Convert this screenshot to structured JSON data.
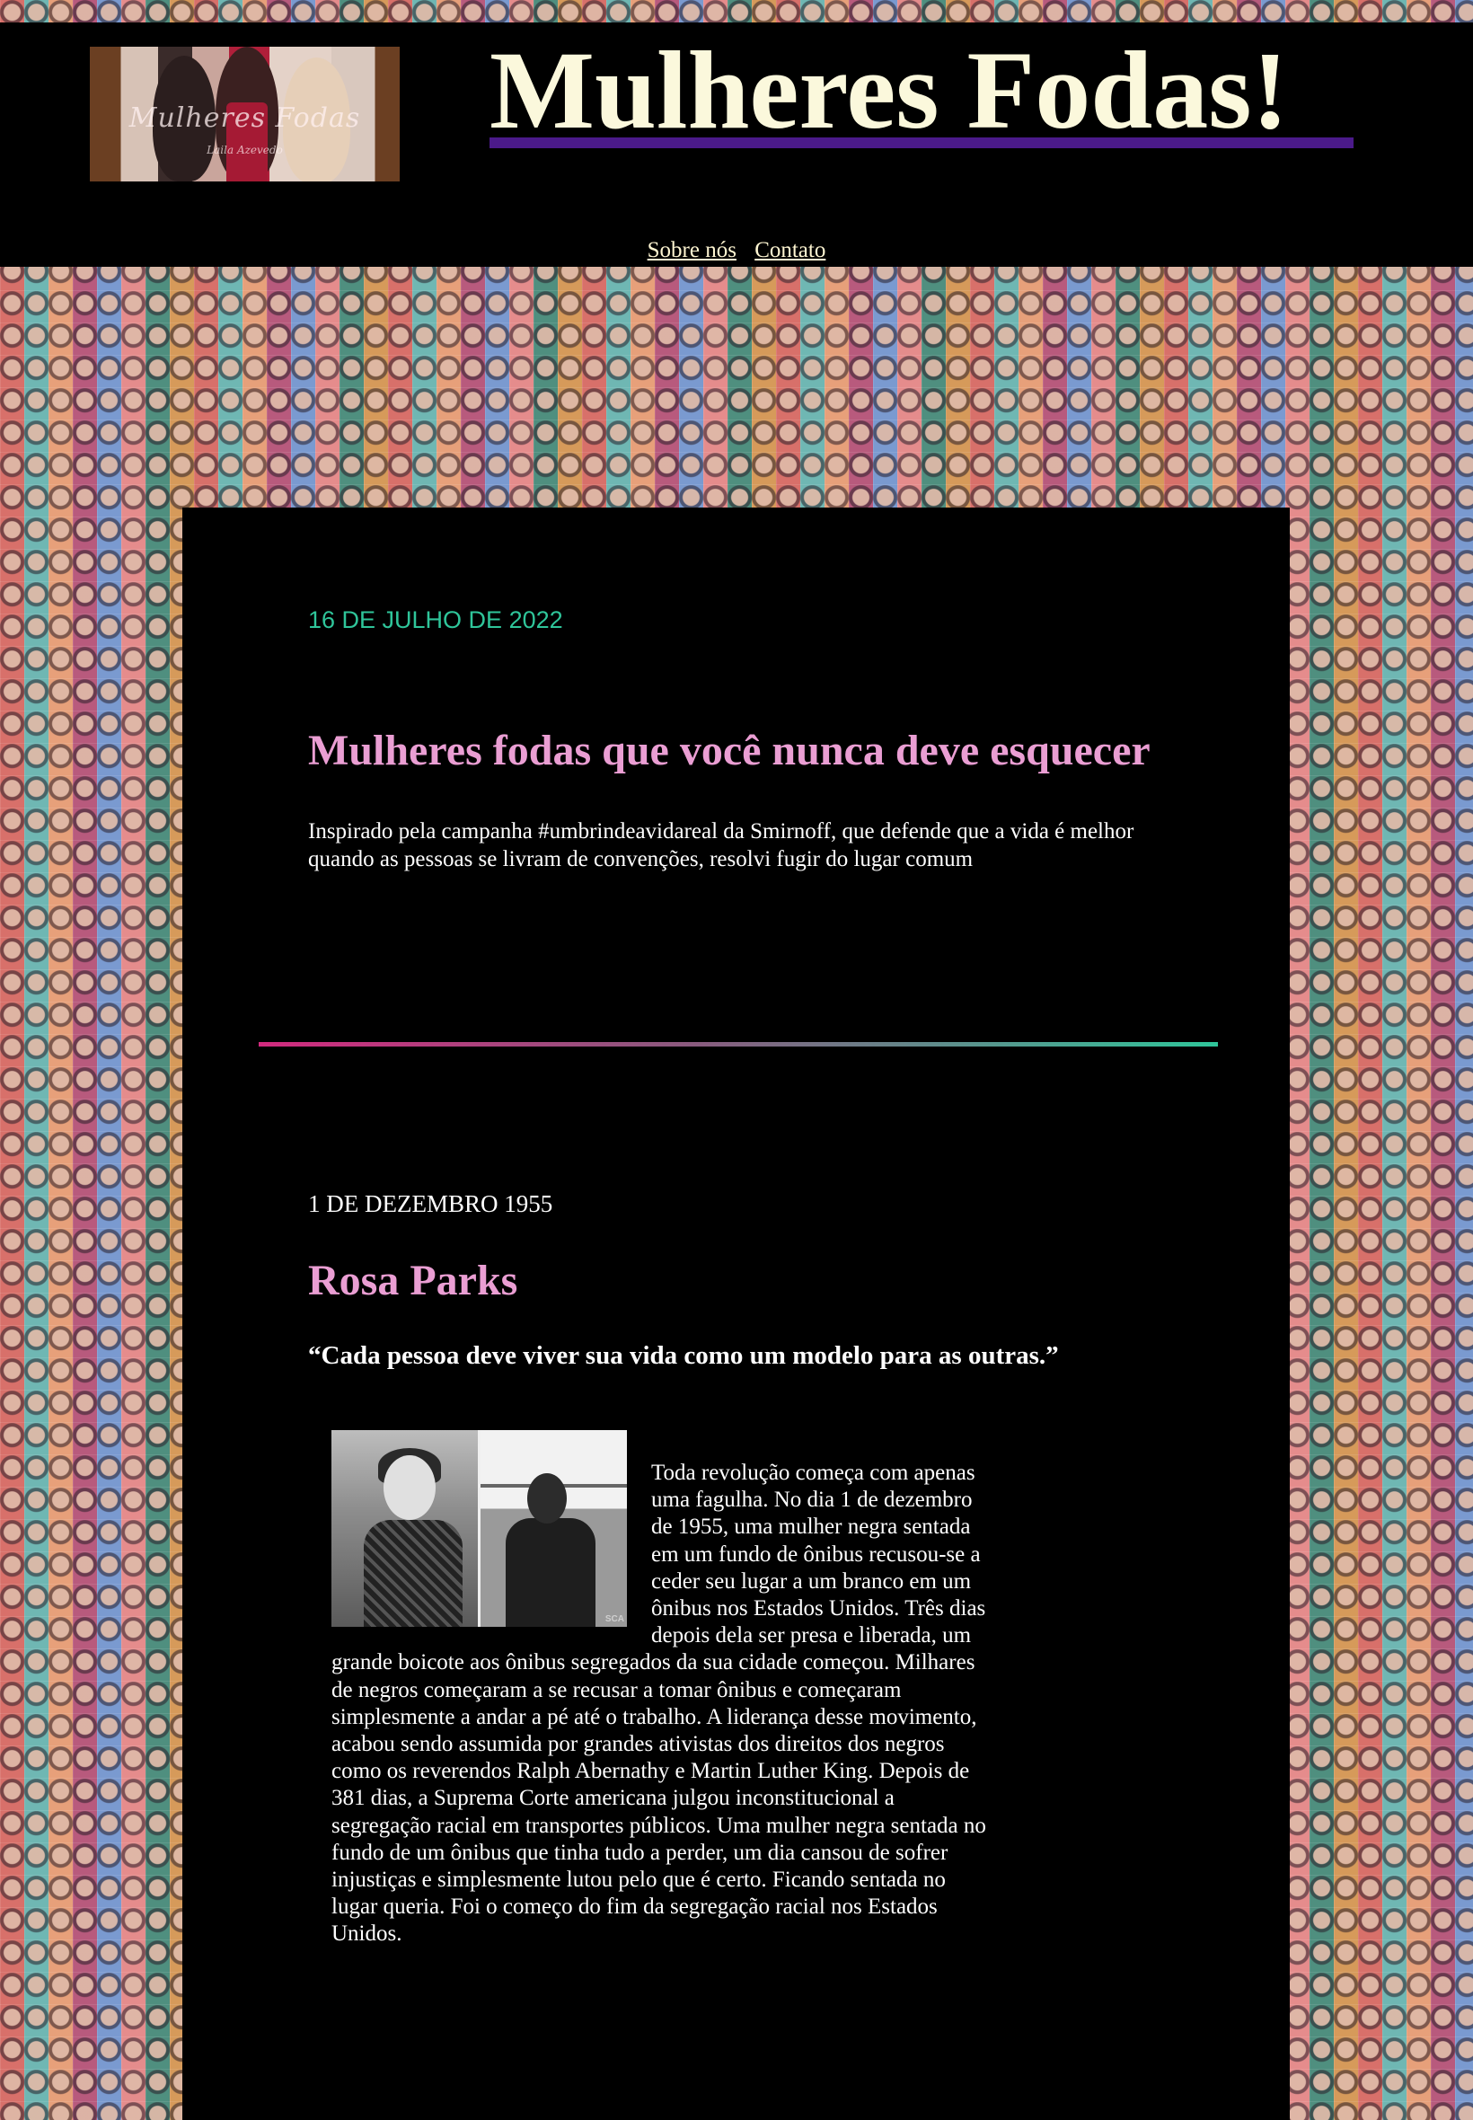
{
  "header": {
    "site_title": "Mulheres Fodas!",
    "logo_text": "Mulheres Fodas",
    "logo_subtext": "Laila Azevedo",
    "underline_color": "#4b1a8a"
  },
  "nav": {
    "items": [
      {
        "label": "Sobre nós"
      },
      {
        "label": "Contato"
      }
    ]
  },
  "post": {
    "date": "16 DE JULHO DE 2022",
    "title": "Mulheres fodas que você nunca deve esquecer",
    "intro": "Inspirado pela campanha #umbrindeavidareal da Smirnoff, que defende que a vida é melhor quando as pessoas se livram de convenções, resolvi fugir do lugar comum"
  },
  "feature": {
    "date": "1 DE DEZEMBRO 1955",
    "name": "Rosa Parks",
    "quote": "“Cada pessoa deve viver sua vida como um modelo para as outras.”",
    "photo_watermark": "SCA",
    "body": "Toda revolução começa com apenas uma fagulha. No dia 1 de dezembro de 1955, uma mulher negra sentada em um fundo de ônibus recusou-se a ceder seu lugar a um branco em um ônibus nos Estados Unidos. Três dias depois dela ser presa e liberada, um grande boicote aos ônibus segregados da sua cidade começou. Milhares de negros começaram a se recusar a tomar ônibus e começaram simplesmente a andar a pé até o trabalho. A liderança desse movimento, acabou sendo assumida por grandes ativistas dos direitos dos negros como os reverendos Ralph Abernathy e Martin Luther King. Depois de 381 dias, a Suprema Corte americana julgou inconstitucional a segregação racial em transportes públicos. Uma mulher negra sentada no fundo de um ônibus que tinha tudo a perder, um dia cansou de sofrer injustiças e simplesmente lutou pelo que é certo. Ficando sentada no lugar queria. Foi o começo do fim da segregação racial nos Estados Unidos."
  },
  "colors": {
    "date_accent": "#2fc59a",
    "heading_pink": "#ea9ed3",
    "title_cream": "#fbf8dc",
    "divider_start": "#d12a7e",
    "divider_end": "#2fc59a"
  }
}
